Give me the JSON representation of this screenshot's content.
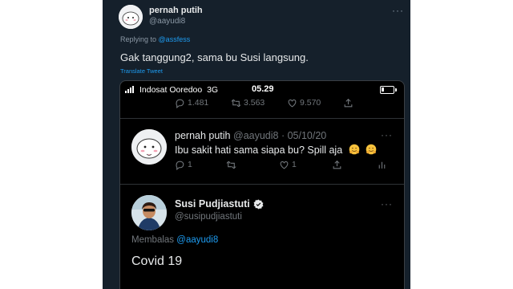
{
  "outer_tweet": {
    "display_name": "pernah putih",
    "handle": "@aayudi8",
    "more": "···",
    "replying_prefix": "Replying to",
    "replying_to": "@assfess",
    "text": "Gak tanggung2, sama bu Susi langsung.",
    "translate": "Translate Tweet"
  },
  "screenshot": {
    "status_bar": {
      "carrier": "Indosat Ooredoo",
      "network": "3G",
      "time": "05.29"
    },
    "top_actions": {
      "replies": "1.481",
      "retweets": "3.563",
      "likes": "9.570"
    },
    "tweet": {
      "display_name": "pernah putih",
      "meta": "@aayudi8 · 05/10/20",
      "more": "···",
      "text": "Ibu sakit hati sama siapa bu? Spill aja",
      "reply_count": "1",
      "like_count": "1"
    },
    "reply": {
      "display_name": "Susi Pudjiastuti",
      "handle": "@susipudjiastuti",
      "more": "···",
      "membalas_prefix": "Membalas",
      "membalas_to": "@aayudi8",
      "text": "Covid 19"
    }
  },
  "colors": {
    "background": "#15202b",
    "screenshot_bg": "#000000",
    "text_primary": "#e7e9ea",
    "text_secondary": "#71767b",
    "accent": "#1d9bf0"
  },
  "icons": [
    "reply-icon",
    "retweet-icon",
    "like-icon",
    "share-icon",
    "analytics-icon",
    "verified-icon",
    "hugging-face-emoji",
    "battery-icon",
    "signal-icon",
    "more-icon"
  ]
}
